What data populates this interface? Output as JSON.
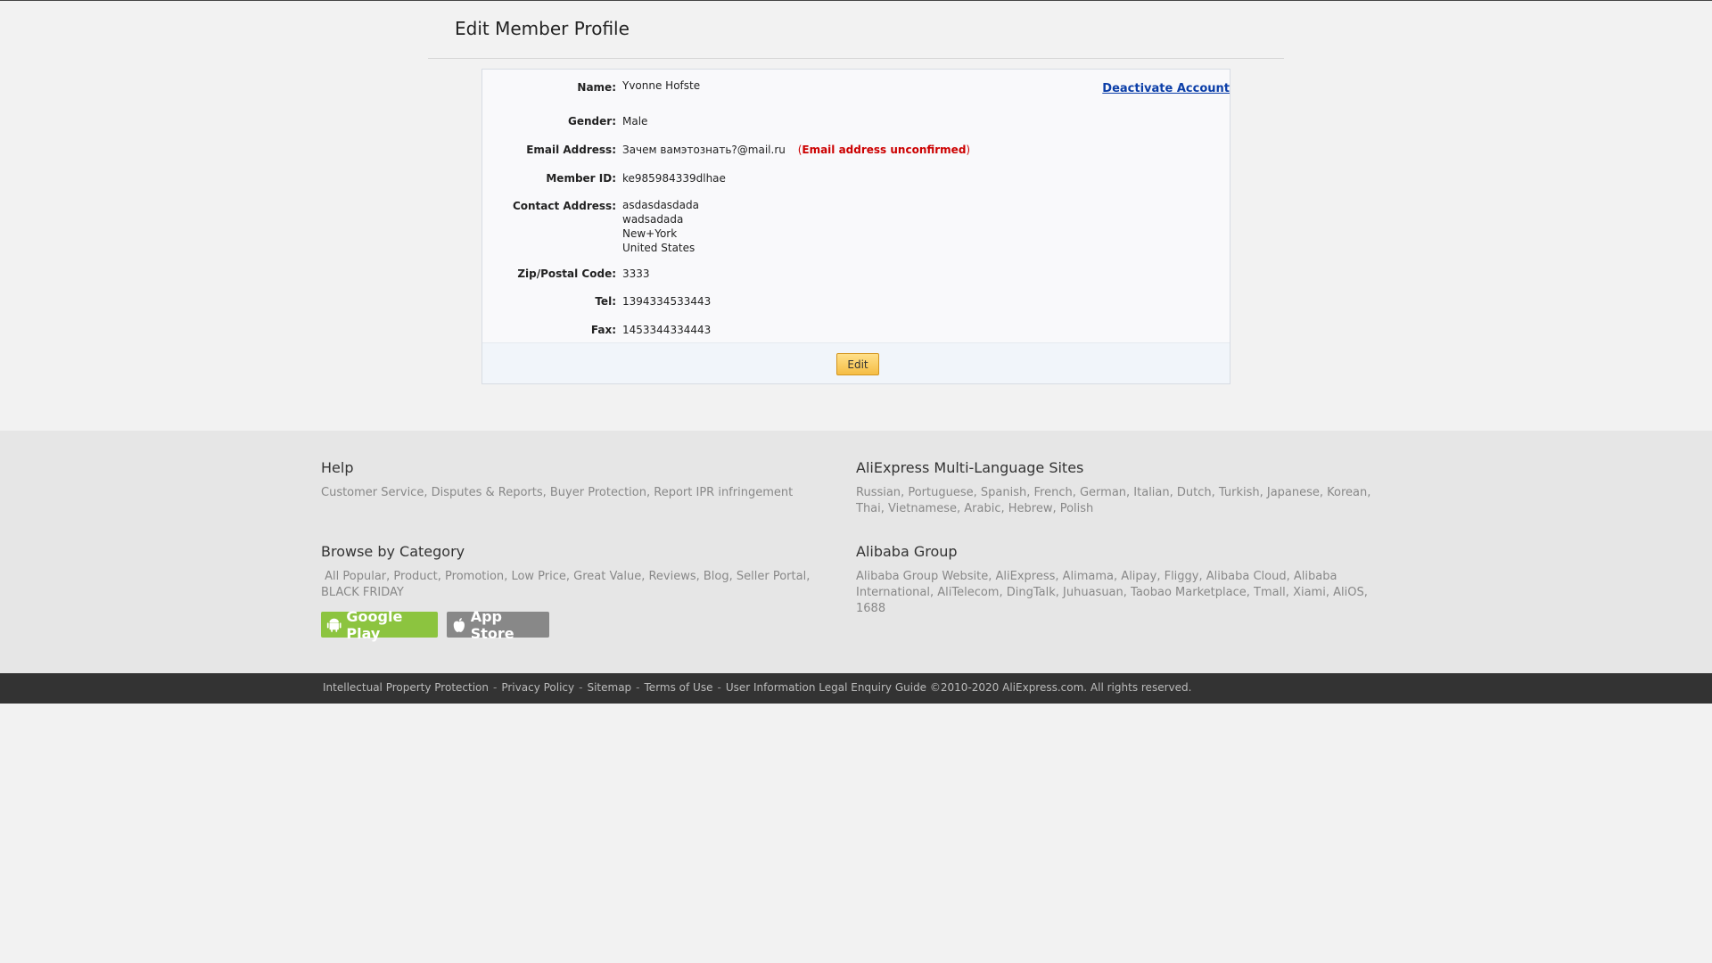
{
  "page": {
    "title": "Edit Member Profile"
  },
  "profile": {
    "deactivate_label": "Deactivate Account",
    "name_label": "Name:",
    "name": "Yvonne  Hofste",
    "gender_label": "Gender:",
    "gender": "Male",
    "email_label": "Email Address:",
    "email": "Зачем вамэтознать?@mail.ru",
    "email_warning_open": "(",
    "email_warning": "Email address unconfirmed",
    "email_warning_close": ")",
    "member_id_label": "Member ID:",
    "member_id": "ke985984339dlhae",
    "address_label": "Contact Address:",
    "address_lines": [
      "asdasdasdada",
      "wadsadada",
      "New+York",
      "United States"
    ],
    "zip_label": "Zip/Postal Code:",
    "zip": "3333",
    "tel_label": "Tel:",
    "tel": "1394334533443",
    "fax_label": "Fax:",
    "fax": "1453344334443",
    "edit_label": "Edit"
  },
  "footer": {
    "help": {
      "heading": "Help",
      "links": [
        "Customer Service",
        "Disputes & Reports",
        "Buyer Protection",
        "Report IPR infringement"
      ]
    },
    "languages": {
      "heading": "AliExpress Multi-Language Sites",
      "links": [
        "Russian",
        "Portuguese",
        "Spanish",
        "French",
        "German",
        "Italian",
        "Dutch",
        "Turkish",
        "Japanese",
        "Korean",
        "Thai",
        "Vietnamese",
        "Arabic",
        "Hebrew",
        "Polish"
      ]
    },
    "category": {
      "heading": "Browse by Category",
      "links": [
        "All Popular",
        "Product",
        "Promotion",
        "Low Price",
        "Great Value",
        "Reviews",
        "Blog",
        "Seller Portal",
        "BLACK FRIDAY"
      ]
    },
    "group": {
      "heading": "Alibaba Group",
      "links": [
        "Alibaba Group Website",
        "AliExpress",
        "Alimama",
        "Alipay",
        "Fliggy",
        "Alibaba Cloud",
        "Alibaba International",
        "AliTelecom",
        "DingTalk",
        "Juhuasuan",
        "Taobao Marketplace",
        "Tmall",
        "Xiami",
        "AliOS",
        "1688"
      ]
    },
    "google_play": "Google Play",
    "app_store": "App Store",
    "bottom_links": [
      "Intellectual Property Protection",
      "Privacy Policy",
      "Sitemap",
      "Terms of Use",
      "User Information Legal Enquiry Guide"
    ],
    "copyright": "©2010-2020 AliExpress.com. All rights reserved."
  },
  "colors": {
    "warning": "#cc0000",
    "link": "#0b3ea8",
    "edit_button": "#f5bd44",
    "google_play": "#8cc43f",
    "footer_bar": "#333333"
  }
}
